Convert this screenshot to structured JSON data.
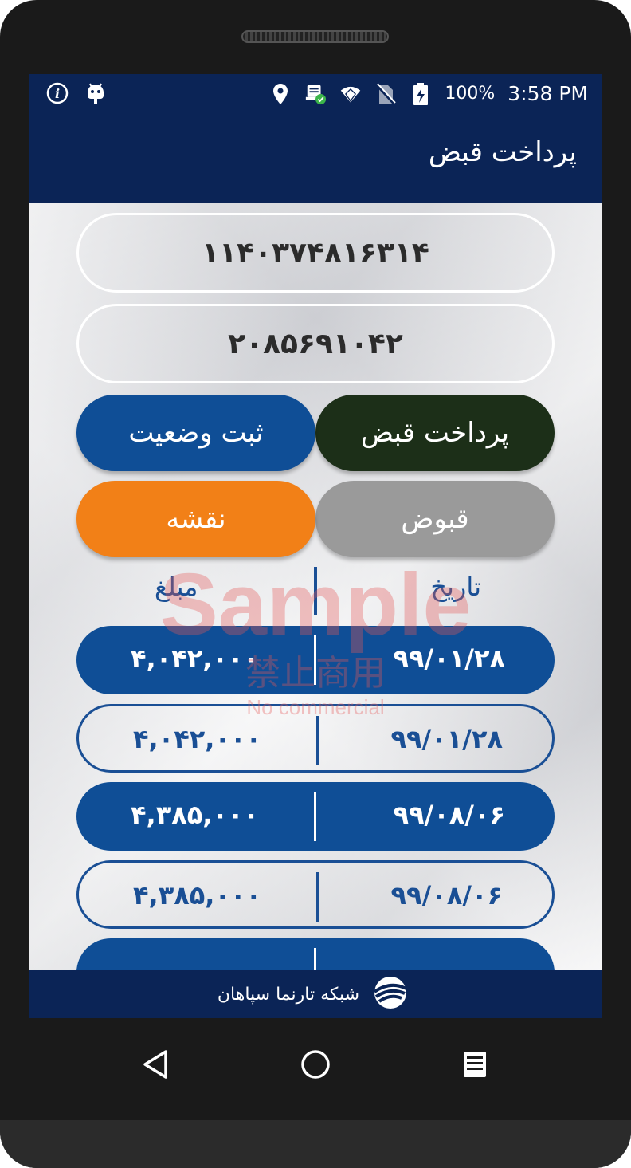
{
  "status_bar": {
    "battery": "100%",
    "time": "3:58 PM",
    "icons": [
      "info-icon",
      "android-icon",
      "location-icon",
      "notification-check-icon",
      "wifi-icon",
      "no-sim-icon",
      "battery-charging-icon"
    ]
  },
  "app_bar": {
    "title": "پرداخت قبض"
  },
  "inputs": {
    "bill_id": "۱۱۴۰۳۷۴۸۱۶۳۱۴",
    "payment_id": "۲۰۸۵۶۹۱۰۴۲"
  },
  "buttons": {
    "pay_bill": "پرداخت قبض",
    "register_status": "ثبت وضعیت",
    "bills": "قبوض",
    "map": "نقشه"
  },
  "table": {
    "header_date": "تاریخ",
    "header_amount": "مبلغ",
    "rows": [
      {
        "date": "۹۹/۰۱/۲۸",
        "amount": "۴,۰۴۲,۰۰۰"
      },
      {
        "date": "۹۹/۰۱/۲۸",
        "amount": "۴,۰۴۲,۰۰۰"
      },
      {
        "date": "۹۹/۰۸/۰۶",
        "amount": "۴,۳۸۵,۰۰۰"
      },
      {
        "date": "۹۹/۰۸/۰۶",
        "amount": "۴,۳۸۵,۰۰۰"
      }
    ]
  },
  "watermark": {
    "main": "Sample",
    "cn": "禁止商用",
    "sub": "No commercial"
  },
  "footer": {
    "text": "شبکه تارنما سپاهان"
  },
  "colors": {
    "primary_dark": "#0b2456",
    "pay_button": "#1c2f18",
    "register_button": "#0f4e96",
    "bills_button": "#9a9a9a",
    "map_button": "#f28017",
    "row_blue": "#0f4e96"
  }
}
